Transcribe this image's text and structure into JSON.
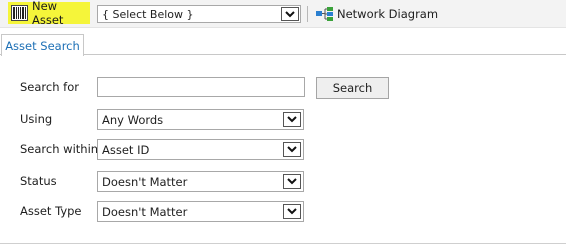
{
  "toolbar": {
    "new_asset_label": "New Asset",
    "new_asset_icon": "barcode-icon",
    "select_value": "{ Select Below }",
    "network_diagram_label": "Network Diagram",
    "network_icon": "network-diagram-icon",
    "highlight_color": "#f5f53a"
  },
  "tabs": [
    {
      "label": "Asset Search",
      "active": true
    }
  ],
  "form": {
    "search_for": {
      "label": "Search for",
      "value": ""
    },
    "search_button": "Search",
    "using": {
      "label": "Using",
      "value": "Any Words"
    },
    "search_within": {
      "label": "Search within",
      "value": "Asset ID"
    },
    "status": {
      "label": "Status",
      "value": "Doesn't Matter"
    },
    "asset_type": {
      "label": "Asset Type",
      "value": "Doesn't Matter"
    }
  },
  "colors": {
    "tab_text": "#1c6fb5",
    "toolbar_bg": "#f3f3f3"
  }
}
